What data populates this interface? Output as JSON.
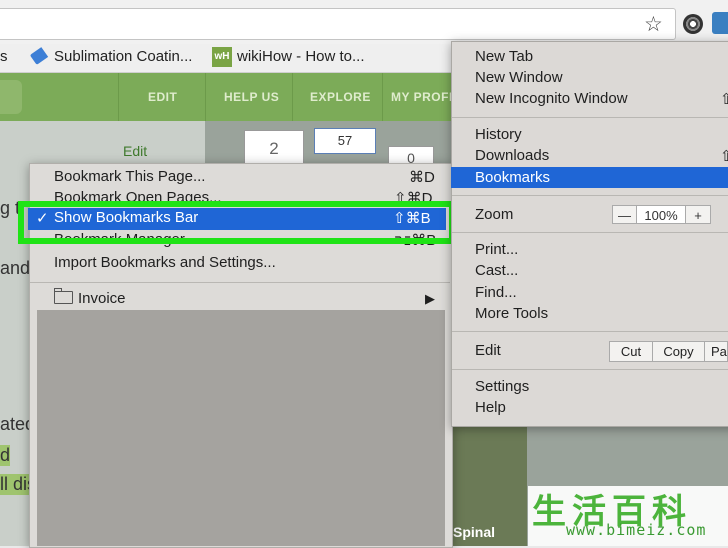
{
  "toolbar": {
    "star_icon": "☆"
  },
  "bookmarks_bar": {
    "items": [
      {
        "label": "s"
      },
      {
        "label": "Sublimation Coatin..."
      },
      {
        "label": "wikiHow - How to..."
      }
    ],
    "wikihow_icon_text": "wH"
  },
  "page": {
    "nav": [
      "EDIT",
      "HELP US",
      "EXPLORE",
      "MY PROFIL"
    ],
    "edit_link": "Edit",
    "step_number": "2",
    "like_count": "57",
    "zero_count": "0",
    "side_text": [
      "g t",
      "and",
      "ated",
      "d",
      "ll dis"
    ],
    "image_caption": "Spinal"
  },
  "bookmarks_submenu": {
    "items": [
      {
        "label": "Bookmark This Page...",
        "shortcut": "⌘D"
      },
      {
        "label": "Bookmark Open Pages...",
        "shortcut": "⇧⌘D"
      },
      {
        "label": "Show Bookmarks Bar",
        "shortcut": "⇧⌘B",
        "checked": "✓"
      },
      {
        "label": "Bookmark Manager",
        "shortcut": "⌥⌘B"
      },
      {
        "label": "Import Bookmarks and Settings..."
      }
    ],
    "folder": {
      "label": "Invoice",
      "arrow": "▶"
    }
  },
  "main_menu": {
    "group1": [
      "New Tab",
      "New Window",
      "New Incognito Window"
    ],
    "group2": [
      "History",
      "Downloads",
      "Bookmarks"
    ],
    "zoom": {
      "label": "Zoom",
      "minus": "—",
      "value": "100%",
      "plus": "+"
    },
    "group3": [
      "Print...",
      "Cast...",
      "Find...",
      "More Tools"
    ],
    "edit": {
      "label": "Edit",
      "cut": "Cut",
      "copy": "Copy",
      "paste": "Pa"
    },
    "group4": [
      "Settings",
      "Help"
    ],
    "shortcut_fragments": [
      "⇧",
      "⇧"
    ]
  },
  "watermark": {
    "chars": "生活百科",
    "url": "www.bimeiz.com"
  },
  "colors": {
    "highlight": "#1f66d6",
    "outline": "#1fe316",
    "site_green": "#7cab58"
  }
}
